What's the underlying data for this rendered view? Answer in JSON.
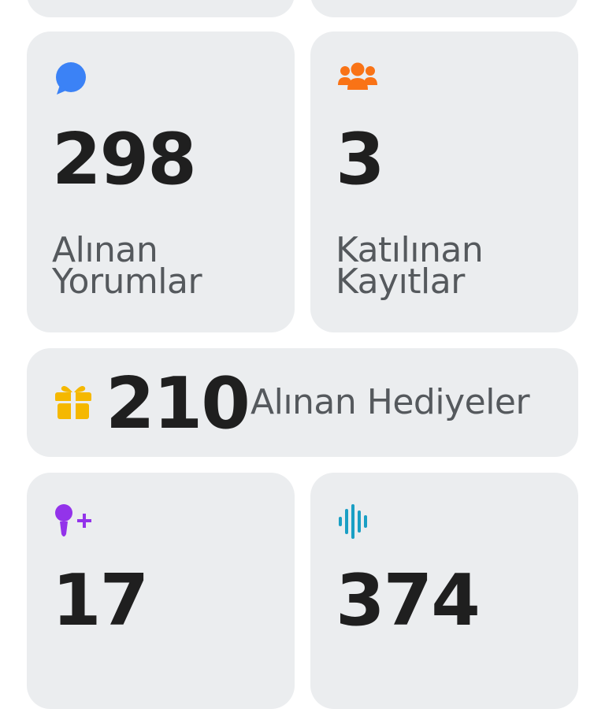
{
  "stats": {
    "comments": {
      "value": "298",
      "label_line1": "Alınan",
      "label_line2": "Yorumlar",
      "icon": "chat-bubble-icon",
      "color": "#3b82f6"
    },
    "participations": {
      "value": "3",
      "label_line1": "Katılınan",
      "label_line2": "Kayıtlar",
      "icon": "group-icon",
      "color": "#f97316"
    },
    "gifts": {
      "value": "210",
      "label": "Alınan Hediyeler",
      "icon": "gift-icon",
      "color": "#f5b800"
    },
    "karaoke": {
      "value": "17",
      "icon": "microphone-plus-icon",
      "color": "#9333ea"
    },
    "recordings": {
      "value": "374",
      "icon": "sound-wave-icon",
      "color": "#1a9fc4"
    }
  }
}
